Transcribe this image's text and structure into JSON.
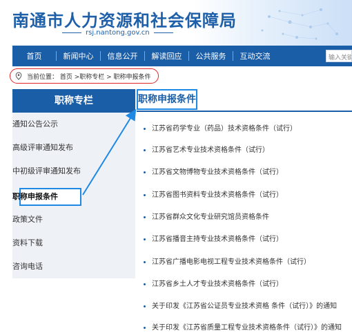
{
  "header": {
    "site_title": "南通市人力资源和社会保障局",
    "site_url": "rsj.nantong.gov.cn"
  },
  "nav": {
    "items": [
      "首页",
      "新闻中心",
      "信息公开",
      "解读回应",
      "公共服务",
      "互动交流"
    ],
    "search_placeholder": "输入关键"
  },
  "breadcrumb": {
    "text": "当前位置：  首页 >职称专栏 > 职称申报条件"
  },
  "sidebar": {
    "title": "职称专栏",
    "items": [
      {
        "label": "通知公告公示",
        "active": false
      },
      {
        "label": "高级评审通知发布",
        "active": false
      },
      {
        "label": "中初级评审通知发布",
        "active": false
      },
      {
        "label": "职称申报条件",
        "active": true
      },
      {
        "label": "政策文件",
        "active": false
      },
      {
        "label": "资料下载",
        "active": false
      },
      {
        "label": "咨询电话",
        "active": false
      }
    ]
  },
  "main": {
    "title": "职称申报条件",
    "list": [
      "江苏省药学专业（药品）技术资格条件（试行）",
      "江苏省艺术专业技术资格条件（试行）",
      "江苏省文物博物专业技术资格条件（试行）",
      "江苏省图书资料专业技术资格条件（试行）",
      "江苏省群众文化专业研究馆员资格条件",
      "江苏省播音主持专业技术资格条件（试行）",
      "江苏省广播电影电视工程专业技术资格条件（试行）",
      "江苏省乡土人才专业技术资格条件（试行）",
      "关于印发《江苏省公证员专业技术资格 条件（试行）》的通知",
      "关于印发《江苏省质量工程专业技术资格条件（试行）》的通知"
    ]
  },
  "colors": {
    "brand_blue": "#1b5ea8",
    "highlight_blue": "#1e88e5",
    "highlight_red": "#e02424"
  }
}
